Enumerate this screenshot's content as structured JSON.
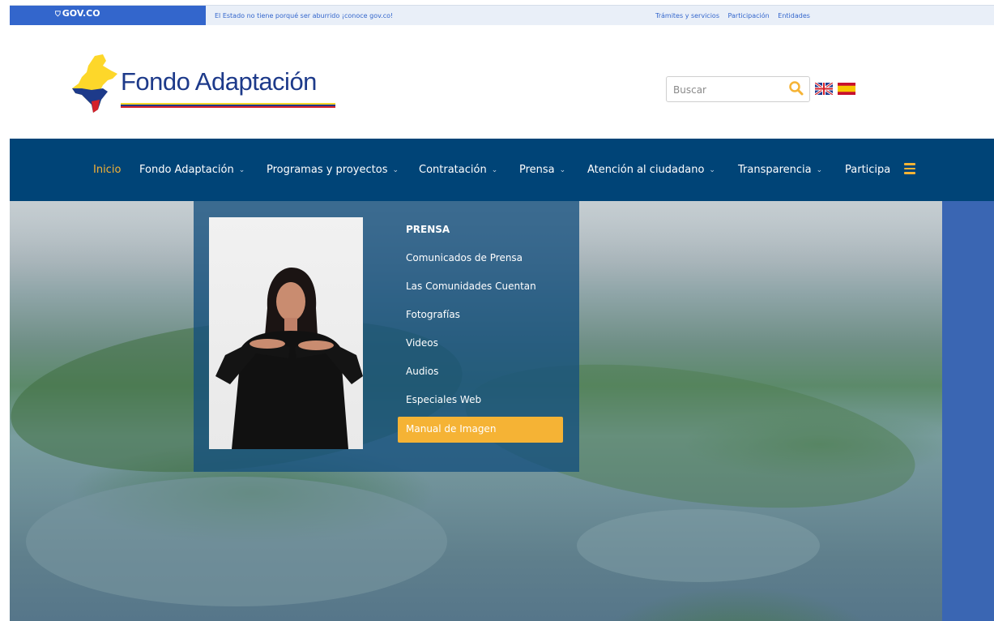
{
  "gov_bar": {
    "brand": "GOV.CO",
    "message": "El Estado no tiene porqué ser aburrido ¡conoce gov.co!",
    "links": [
      "Trámites y servicios",
      "Participación",
      "Entidades"
    ],
    "brand_color": "#3366cc"
  },
  "header": {
    "logo_text": "Fondo Adaptación",
    "search": {
      "placeholder": "Buscar"
    },
    "languages": [
      "english-flag-icon",
      "spanish-flag-icon"
    ]
  },
  "nav": {
    "background": "#004477",
    "accent": "#f5b335",
    "items": [
      {
        "label": "Inicio",
        "dropdown": false,
        "active": true
      },
      {
        "label": "Fondo Adaptación",
        "dropdown": true
      },
      {
        "label": "Programas y proyectos",
        "dropdown": true
      },
      {
        "label": "Contratación",
        "dropdown": true
      },
      {
        "label": "Prensa",
        "dropdown": true
      },
      {
        "label": "Atención al ciudadano",
        "dropdown": true
      },
      {
        "label": "Transparencia",
        "dropdown": true
      },
      {
        "label": "Participa",
        "dropdown": false
      }
    ],
    "chevron": "⌄"
  },
  "dropdown": {
    "title": "PRENSA",
    "items": [
      "Comunicados de Prensa",
      "Las Comunidades Cuentan",
      "Fotografías",
      "Videos",
      "Audios",
      "Especiales Web",
      "Manual de Imagen"
    ],
    "highlighted_index": 6
  }
}
